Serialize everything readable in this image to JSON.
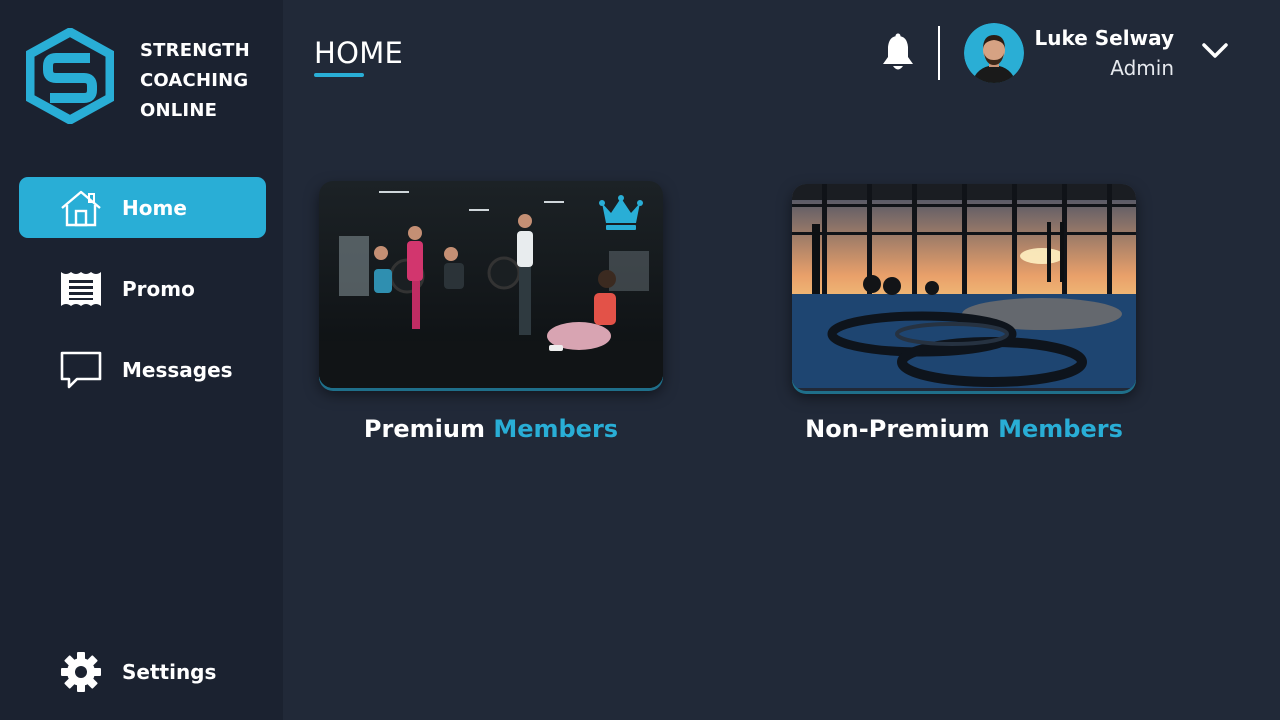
{
  "brand": {
    "line1": "STRENGTH",
    "line2": "COACHING",
    "line3": "ONLINE"
  },
  "sidebar": {
    "items": [
      {
        "label": "Home",
        "icon": "home-icon",
        "active": true
      },
      {
        "label": "Promo",
        "icon": "receipt-icon",
        "active": false
      },
      {
        "label": "Messages",
        "icon": "chat-icon",
        "active": false
      }
    ],
    "settings": {
      "label": "Settings",
      "icon": "gear-icon"
    }
  },
  "header": {
    "title": "HOME",
    "notification_icon": "bell-icon",
    "user": {
      "name": "Luke Selway",
      "role": "Admin"
    },
    "dropdown_icon": "chevron-down-icon"
  },
  "cards": [
    {
      "prefix": "Premium",
      "accent": "Members",
      "badge_icon": "crown-icon"
    },
    {
      "prefix": "Non-Premium",
      "accent": "Members"
    }
  ],
  "colors": {
    "background": "#212938",
    "sidebar": "#1b2230",
    "accent": "#29aed6",
    "text": "#ffffff"
  }
}
